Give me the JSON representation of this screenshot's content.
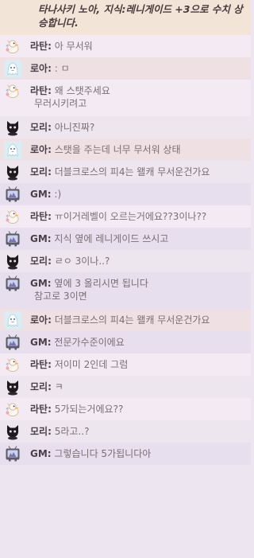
{
  "system_message": "타나사키 노아, 지식:레니게이드 +3으로 수치 상승합니다.",
  "speakers": {
    "ra": {
      "label": "라탄:",
      "avatar": "duck-avatar-icon"
    },
    "ro": {
      "label": "로아:",
      "avatar": "ghost-avatar-icon"
    },
    "mo": {
      "label": "모리:",
      "avatar": "black-cat-avatar-icon"
    },
    "gm": {
      "label": "GM:",
      "avatar": "tv-avatar-icon"
    }
  },
  "messages": [
    {
      "speaker": "ra",
      "text": "아 무서워"
    },
    {
      "speaker": "ro",
      "text": ": ㅁ"
    },
    {
      "speaker": "ra",
      "text": "왜 스탯주세요",
      "cont": "무러시키려고"
    },
    {
      "speaker": "mo",
      "text": "아니진짜?"
    },
    {
      "speaker": "ro",
      "text": "스탯을 주는데 너무 무서워 상태"
    },
    {
      "speaker": "mo",
      "text": "더블크로스의 피4는 왤캐 무서운건가요"
    },
    {
      "speaker": "gm",
      "text": ":)"
    },
    {
      "speaker": "ra",
      "text": "ㅠ이거레벨이 오르는거에요??3이나??"
    },
    {
      "speaker": "gm",
      "text": "지식 옆에 레니게이드 쓰시고"
    },
    {
      "speaker": "mo",
      "text": "ㄹㅇ 3이나..?"
    },
    {
      "speaker": "gm",
      "text": "옆에 3 올리시면 됩니다",
      "cont": "참고로 3이면"
    },
    {
      "speaker": "ro",
      "text": "더블크로스의 피4는 왤캐 무서운건가요"
    },
    {
      "speaker": "gm",
      "text": "전문가수준이에요"
    },
    {
      "speaker": "ra",
      "text": "저이미 2인데 그럼"
    },
    {
      "speaker": "mo",
      "text": "ㅋ"
    },
    {
      "speaker": "ra",
      "text": "5가되는거에요??"
    },
    {
      "speaker": "mo",
      "text": "5라고..?"
    },
    {
      "speaker": "gm",
      "text": "그렇습니다 5가됩니다아"
    }
  ]
}
